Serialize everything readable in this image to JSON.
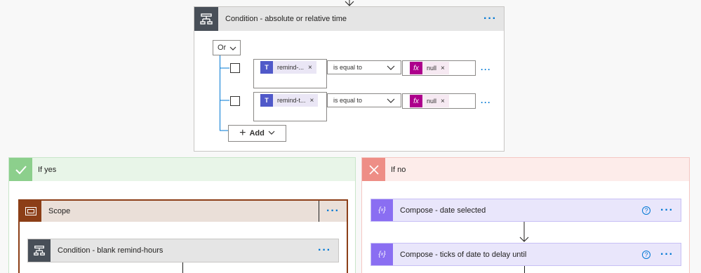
{
  "condition_card": {
    "title": "Condition - absolute or relative time",
    "group_operator": "Or",
    "rows": [
      {
        "token": "remind-...",
        "operator": "is equal to",
        "value": "null"
      },
      {
        "token": "remind-t...",
        "operator": "is equal to",
        "value": "null"
      }
    ],
    "add_label": "Add"
  },
  "if_yes": {
    "label": "If yes",
    "scope_title": "Scope",
    "inner_condition_title": "Condition - blank remind-hours"
  },
  "if_no": {
    "label": "If no",
    "compose1_title": "Compose - date selected",
    "compose2_title": "Compose - ticks of date to delay until"
  },
  "icons": {
    "close": "×",
    "chevron": "chevron-down-icon",
    "help": "?",
    "more": "···",
    "fx": "fx"
  },
  "colors": {
    "condition_icon_bg": "#484f58",
    "yes_header_bg": "#e8f5e8",
    "yes_icon_bg": "#8ccf8c",
    "no_header_bg": "#fdecea",
    "no_icon_bg": "#ee8e86",
    "scope_bg": "#eadfd8",
    "scope_icon_bg": "#8c3e17",
    "compose_bg": "#e9e6fb",
    "compose_icon_bg": "#8a6ef2",
    "teams_icon_bg": "#5059c9",
    "fx_icon_bg": "#ad008c",
    "link_blue": "#0078d4"
  }
}
